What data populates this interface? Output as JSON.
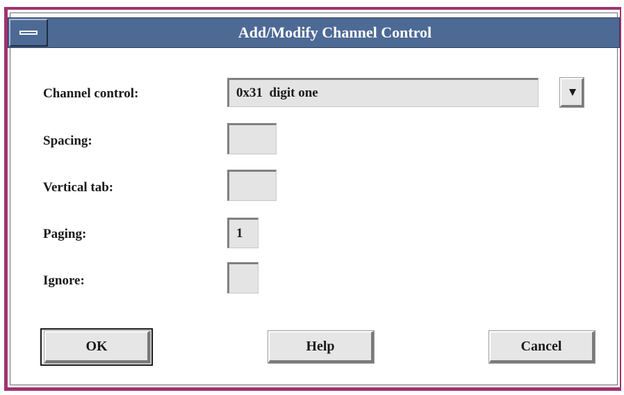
{
  "dialog": {
    "title": "Add/Modify Channel Control"
  },
  "fields": {
    "channel_control": {
      "label": "Channel control:",
      "value": "0x31  digit one"
    },
    "spacing": {
      "label": "Spacing:",
      "value": ""
    },
    "vertical_tab": {
      "label": "Vertical tab:",
      "value": ""
    },
    "paging": {
      "label": "Paging:",
      "value": "1"
    },
    "ignore": {
      "label": "Ignore:",
      "value": ""
    }
  },
  "buttons": {
    "ok": "OK",
    "help": "Help",
    "cancel": "Cancel"
  },
  "icons": {
    "window_menu": "window-menu-icon",
    "dropdown": "triangle-down-icon"
  },
  "colors": {
    "titlebar": "#4d6a95",
    "frame": "#a0336f",
    "field_bg": "#e4e4e4"
  }
}
